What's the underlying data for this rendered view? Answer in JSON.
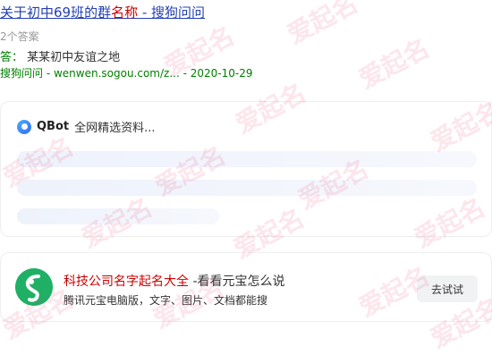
{
  "result": {
    "title_part1": "关于初中69班的群",
    "title_highlight": "名称",
    "title_part2": " - 搜狗问问",
    "answer_count": "2个答案",
    "answer_label": "答：",
    "answer_text": "某某初中友谊之地",
    "source_site": "搜狗问问",
    "source_url": " - wenwen.sogou.com/z... - 2020-10-29"
  },
  "qbot": {
    "brand": "QBot",
    "subtitle": "全网精选资料..."
  },
  "promo": {
    "title": "科技公司名字起名大全",
    "title_suffix": " -看看元宝怎么说",
    "desc": "腾讯元宝电脑版，文字、图片、文档都能搜",
    "button": "去试试"
  },
  "watermark": {
    "text": "爱起名"
  },
  "colors": {
    "link": "#2440b3",
    "highlight": "#cc0000",
    "green": "#008000",
    "watermark": "#e43c6c"
  }
}
